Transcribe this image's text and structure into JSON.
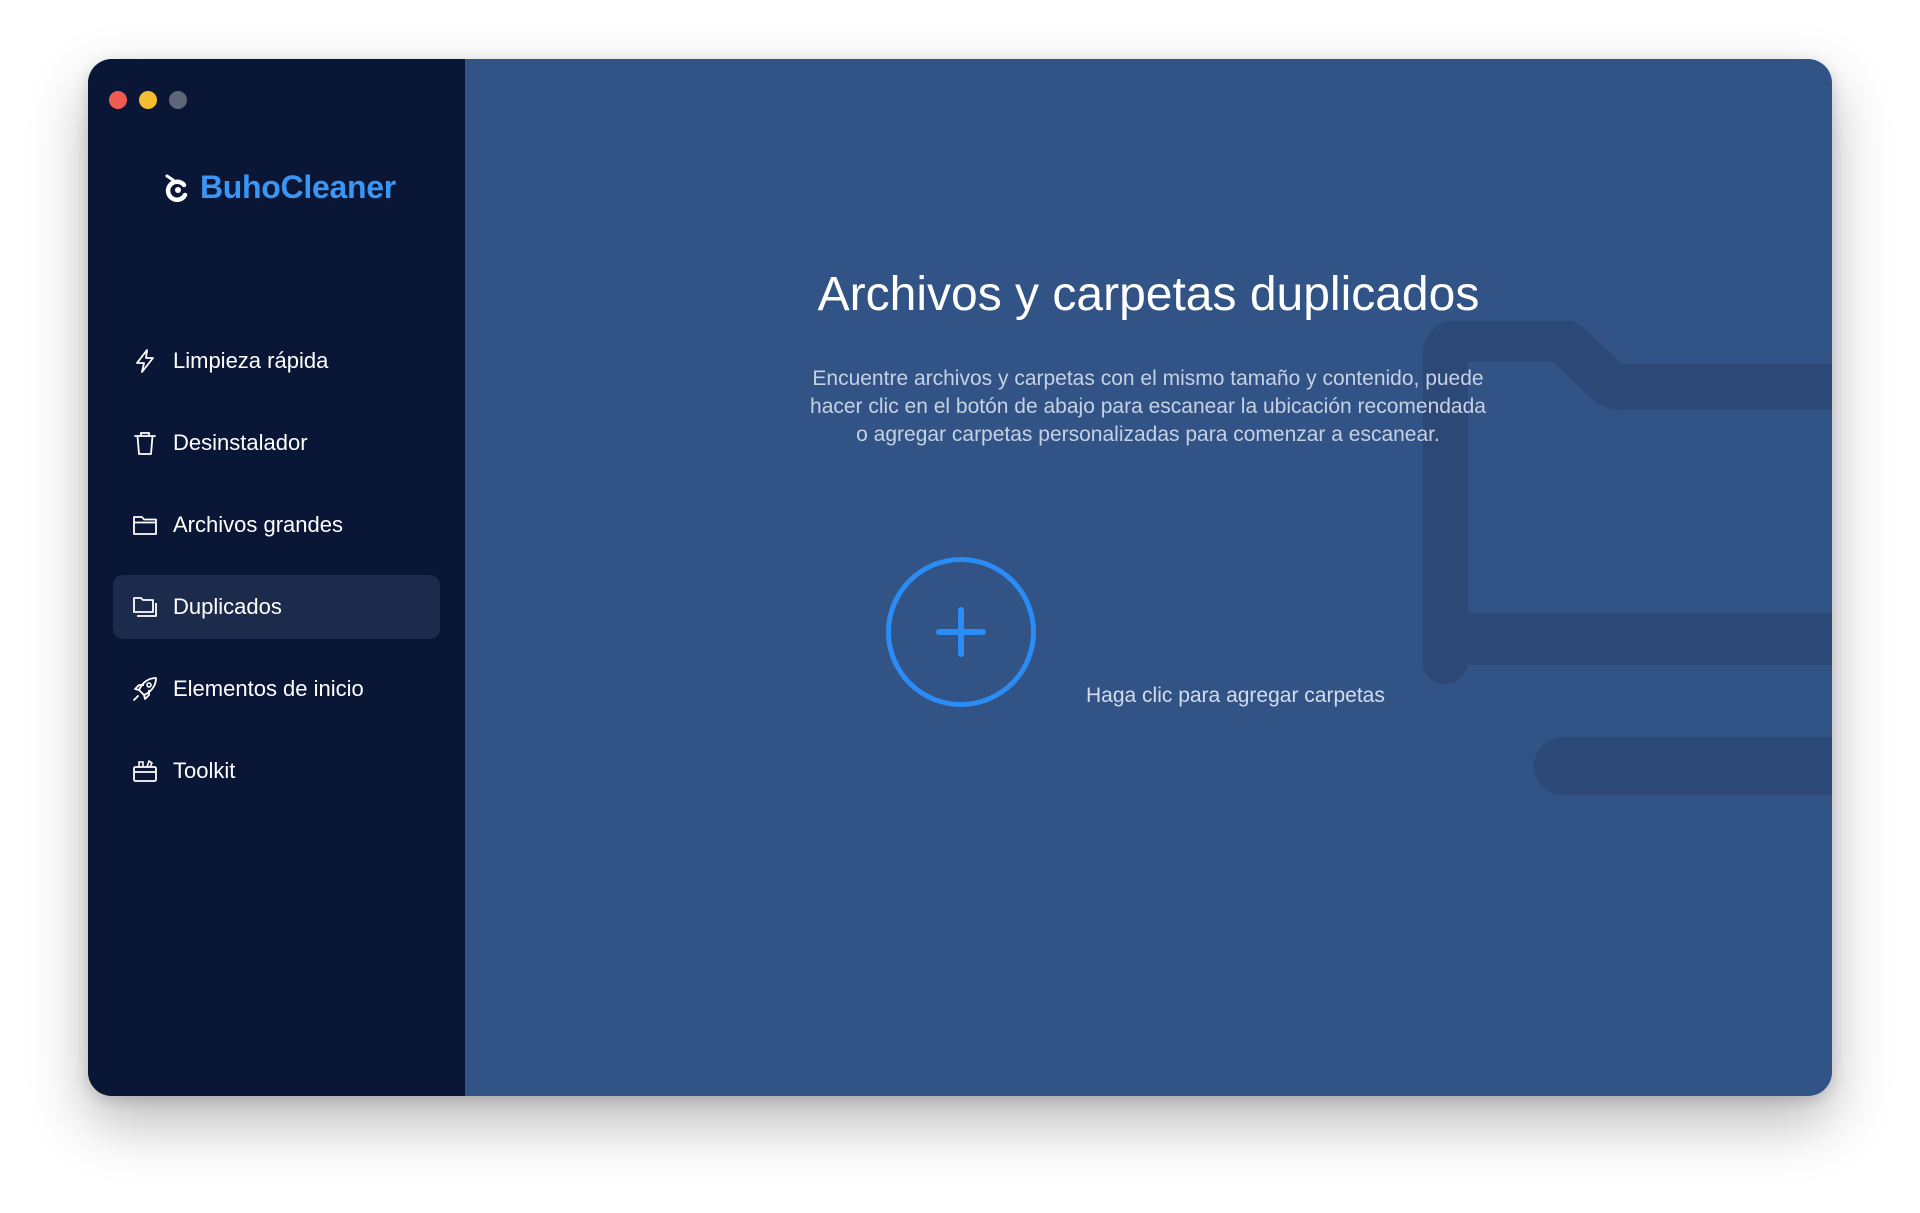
{
  "app": {
    "name": "BuhoCleaner",
    "brand_color": "#3b95f3",
    "icon": "buho-logo-icon"
  },
  "window_controls": {
    "close_color": "#ed5b52",
    "minimize_color": "#f4bd2f",
    "zoom_color": "#5f6677"
  },
  "sidebar": {
    "items": [
      {
        "label": "Limpieza rápida",
        "icon": "lightning-icon",
        "active": false
      },
      {
        "label": "Desinstalador",
        "icon": "trash-icon",
        "active": false
      },
      {
        "label": "Archivos grandes",
        "icon": "folder-icon",
        "active": false
      },
      {
        "label": "Duplicados",
        "icon": "duplicate-folder-icon",
        "active": true
      },
      {
        "label": "Elementos de inicio",
        "icon": "rocket-icon",
        "active": false
      },
      {
        "label": "Toolkit",
        "icon": "toolkit-icon",
        "active": false
      }
    ]
  },
  "main": {
    "title": "Archivos y carpetas duplicados",
    "description": "Encuentre archivos y carpetas con el mismo tamaño y contenido, puede hacer clic en el botón de abajo para escanear la ubicación recomendada o agregar carpetas personalizadas para comenzar a escanear.",
    "add_button_icon": "plus-icon",
    "add_label": "Haga clic para agregar carpetas",
    "accent_color": "#2b8cf5",
    "background_color": "#325386"
  }
}
